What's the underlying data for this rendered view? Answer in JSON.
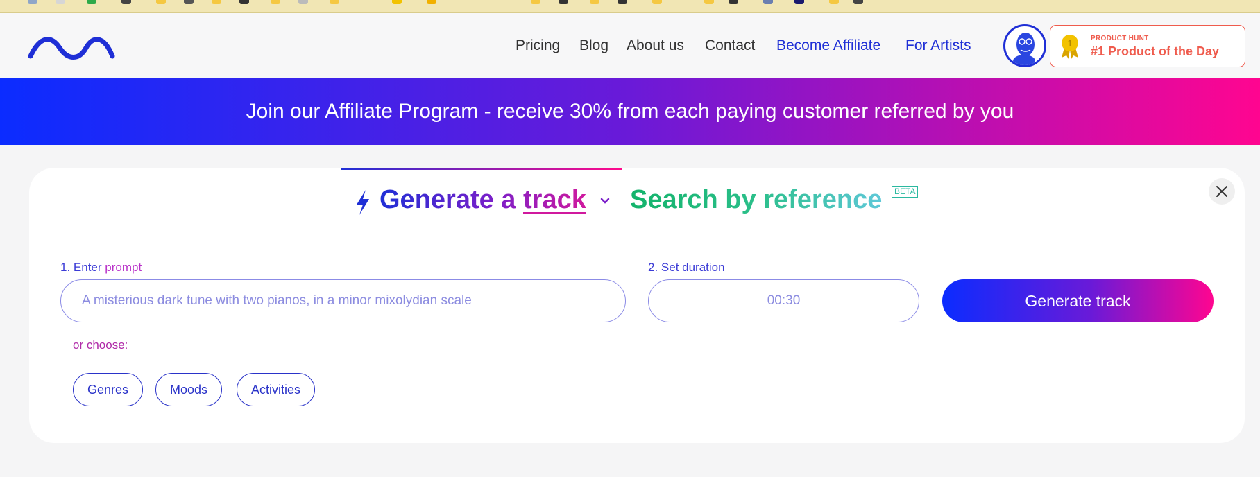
{
  "nav": {
    "items": [
      {
        "label": "Pricing"
      },
      {
        "label": "Blog"
      },
      {
        "label": "About us"
      },
      {
        "label": "Contact"
      },
      {
        "label": "Become Affiliate"
      },
      {
        "label": "For Artists"
      }
    ]
  },
  "product_hunt": {
    "small_label": "PRODUCT HUNT",
    "title": "#1 Product of the Day",
    "medal_number": "1"
  },
  "banner": {
    "text": "Join our Affiliate Program - receive 30% from each paying customer referred by you"
  },
  "tabs": {
    "generate": {
      "prefix": "Generate a ",
      "highlight": "track"
    },
    "search": {
      "label": "Search by ",
      "highlight": "reference",
      "badge": "BETA"
    }
  },
  "form": {
    "prompt_label_number": "1. Enter ",
    "prompt_label_word": "prompt",
    "prompt_placeholder": "A misterious dark tune with two pianos, in a minor mixolydian scale",
    "duration_label": "2. Set duration",
    "duration_value": "00:30",
    "generate_button": "Generate track",
    "or_choose": "or choose:",
    "chips": [
      "Genres",
      "Moods",
      "Activities"
    ]
  },
  "colors": {
    "brand_blue": "#1f2fd6",
    "brand_pink": "#ff0590",
    "product_hunt_red": "#ef5b4d",
    "search_green": "#13b36b"
  }
}
